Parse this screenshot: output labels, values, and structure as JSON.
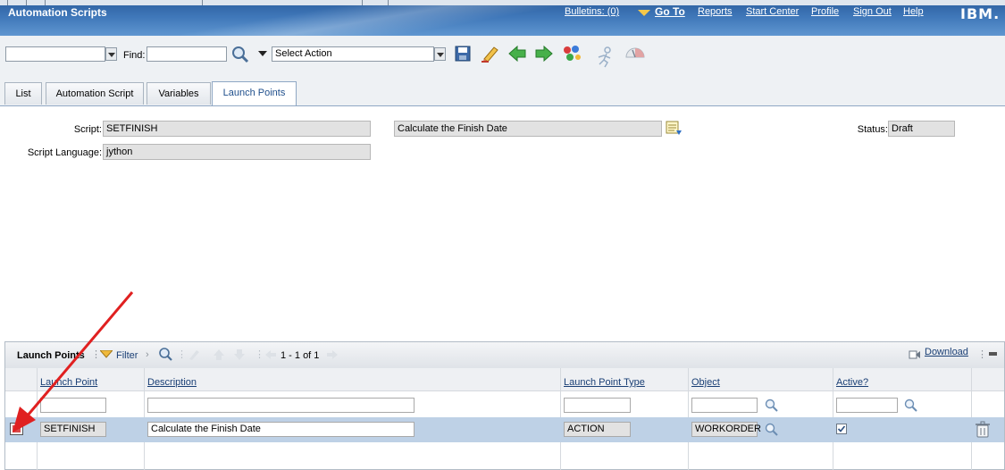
{
  "app": {
    "title": "Automation Scripts",
    "bulletins": "Bulletins: (0)",
    "goto": "Go To",
    "reports": "Reports",
    "start_center": "Start Center",
    "profile": "Profile",
    "sign_out": "Sign Out",
    "help": "Help",
    "brand": "IBM."
  },
  "toolbar": {
    "find_label": "Find:",
    "find_value": "",
    "query_value": "",
    "select_action": "Select Action",
    "icons": [
      "search-icon",
      "save-icon",
      "clear-changes-icon",
      "previous-record-icon",
      "next-record-icon",
      "workflow-icon",
      "route-icon",
      "gauge-icon"
    ]
  },
  "tabs": [
    {
      "label": "List"
    },
    {
      "label": "Automation Script"
    },
    {
      "label": "Variables"
    },
    {
      "label": "Launch Points"
    }
  ],
  "form": {
    "script_label": "Script:",
    "script_value": "SETFINISH",
    "description_value": "Calculate the Finish Date",
    "status_label": "Status:",
    "status_value": "Draft",
    "language_label": "Script Language:",
    "language_value": "jython"
  },
  "launch_points": {
    "title": "Launch Points",
    "filter": "Filter",
    "pagination": "1 - 1 of 1",
    "download": "Download",
    "columns": [
      "Launch Point",
      "Description",
      "Launch Point Type",
      "Object",
      "Active?"
    ],
    "rows": [
      {
        "launch_point": "SETFINISH",
        "description": "Calculate the Finish Date",
        "type": "ACTION",
        "object": "WORKORDER",
        "active": true
      }
    ]
  },
  "colors": {
    "accent": "#3e76b8",
    "annotation_arrow": "#e02020",
    "selected_row": "#bed1e6"
  }
}
